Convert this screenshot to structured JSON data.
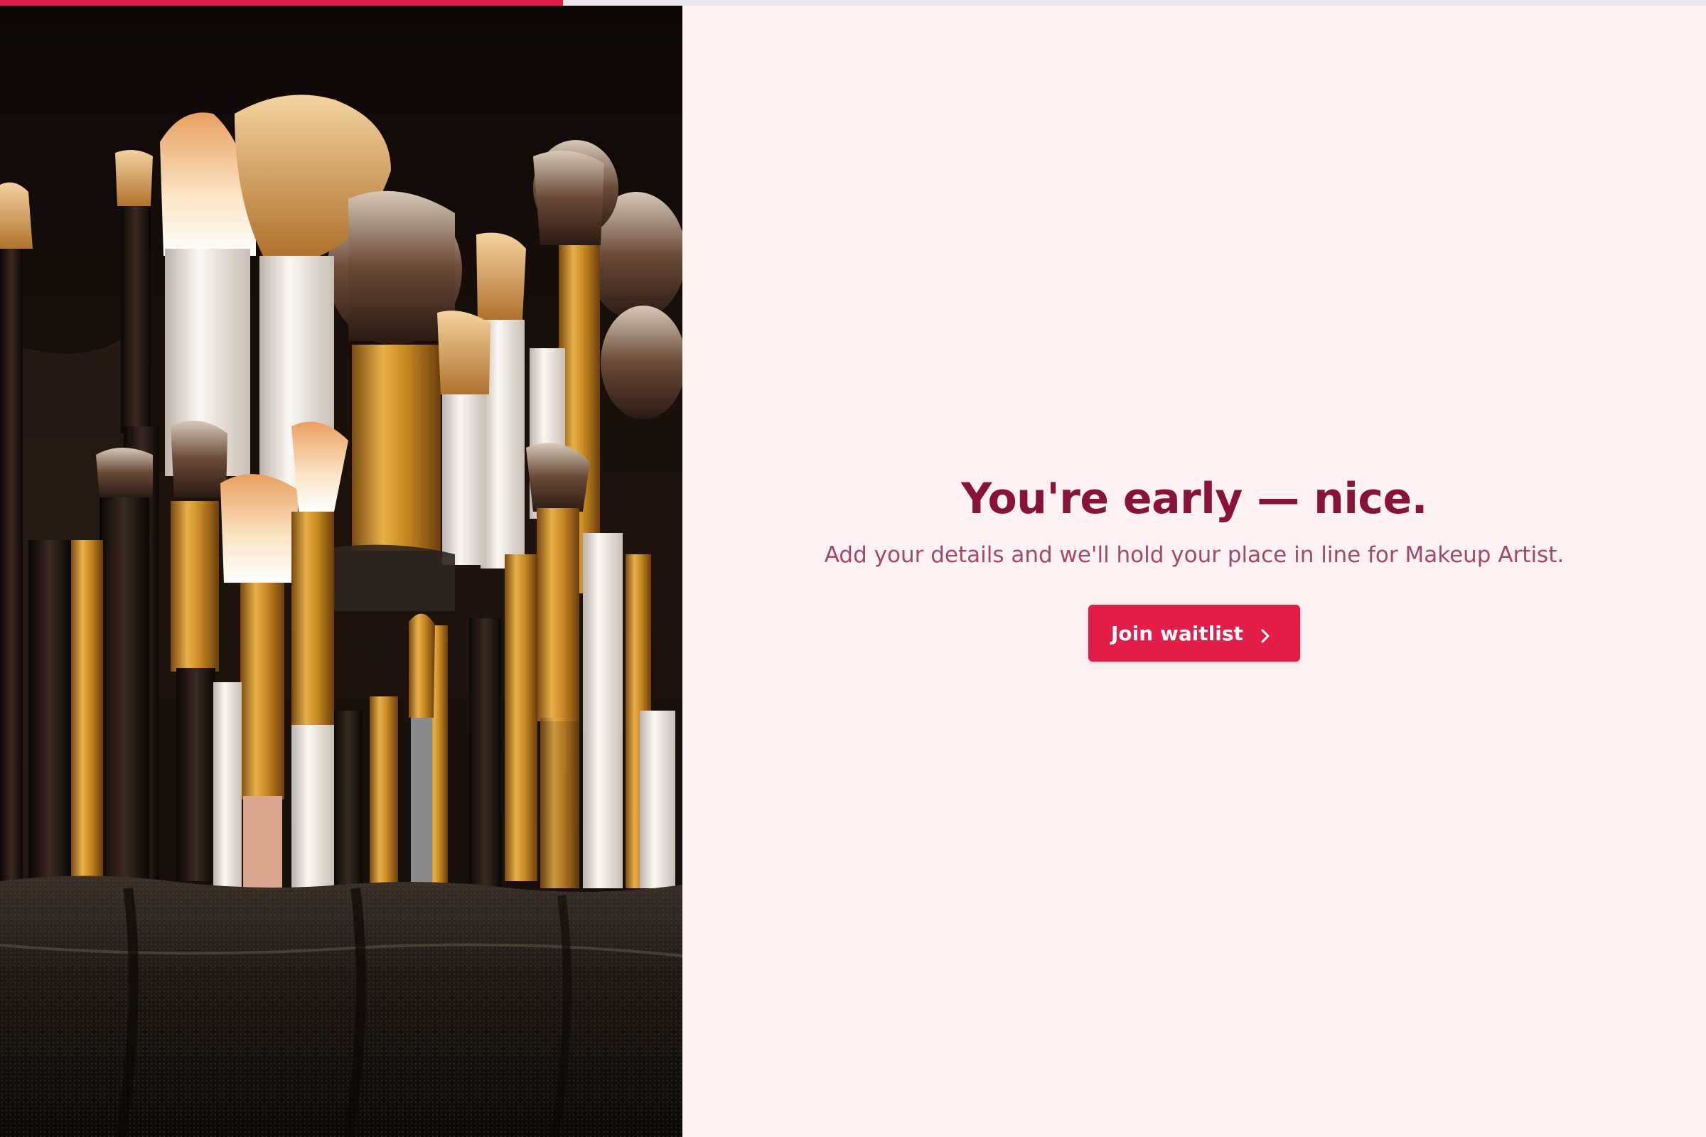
{
  "progress": {
    "value": 0.33
  },
  "hero": {
    "icon": "makeup-brushes-photo"
  },
  "main": {
    "headline": "You're early — nice.",
    "subline": "Add your details and we'll hold your place in line for Makeup Artist.",
    "cta_label": "Join waitlist",
    "cta_icon": "chevron-right-icon"
  },
  "colors": {
    "accent": "#e11d48",
    "headline": "#881337",
    "subtext": "#a04a6a",
    "background": "#fdf1f2",
    "track": "#e9e5e8"
  }
}
